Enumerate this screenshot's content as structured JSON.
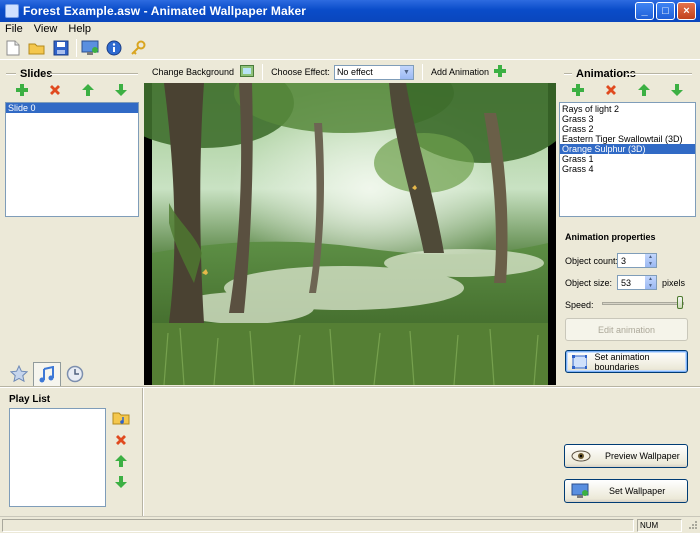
{
  "window": {
    "title": "Forest Example.asw - Animated Wallpaper Maker"
  },
  "menu": [
    "File",
    "View",
    "Help"
  ],
  "toolbar": {
    "icons": [
      "new-file-icon",
      "open-folder-icon",
      "save-icon",
      "monitor-icon",
      "info-icon",
      "key-icon"
    ]
  },
  "slides": {
    "title": "Slides",
    "items": [
      {
        "label": "Slide 0",
        "selected": true
      }
    ]
  },
  "effectbar": {
    "change_background_label": "Change Background",
    "choose_effect_label": "Choose Effect:",
    "effect_value": "No effect",
    "add_animation_label": "Add Animation"
  },
  "animations": {
    "title": "Animations",
    "items": [
      {
        "label": "Rays of light 2",
        "selected": false
      },
      {
        "label": "Grass 3",
        "selected": false
      },
      {
        "label": "Grass 2",
        "selected": false
      },
      {
        "label": "Eastern Tiger Swallowtail (3D)",
        "selected": false
      },
      {
        "label": "Orange Sulphur (3D)",
        "selected": true
      },
      {
        "label": "Grass 1",
        "selected": false
      },
      {
        "label": "Grass 4",
        "selected": false
      }
    ]
  },
  "properties": {
    "title": "Animation properties",
    "object_count_label": "Object count:",
    "object_count_value": "3",
    "object_size_label": "Object size:",
    "object_size_value": "53",
    "object_size_unit": "pixels",
    "speed_label": "Speed:",
    "speed_level": 0.95,
    "edit_animation_label": "Edit animation",
    "set_boundaries_label": "Set animation boundaries"
  },
  "playlist": {
    "title": "Play List"
  },
  "bottom_buttons": {
    "preview_label": "Preview Wallpaper",
    "set_label": "Set Wallpaper"
  },
  "status": {
    "num": "NUM"
  },
  "colors": {
    "selection": "#316ac5",
    "titlebar": "#0a4cc9",
    "face": "#ece9d8",
    "add_green": "#3cb043",
    "delete_red": "#e04a1f"
  }
}
